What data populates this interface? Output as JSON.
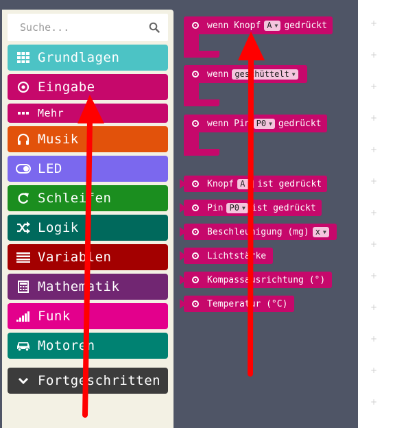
{
  "search": {
    "placeholder": "Suche..."
  },
  "categories": [
    {
      "label": "Grundlagen",
      "color": "#4cc3c5",
      "icon": "grid-icon"
    },
    {
      "label": "Eingabe",
      "color": "#c6086b",
      "icon": "target-icon"
    },
    {
      "label": "Mehr",
      "color": "#c6086b",
      "icon": "more-icon"
    },
    {
      "label": "Musik",
      "color": "#e2520b",
      "icon": "headphones-icon"
    },
    {
      "label": "LED",
      "color": "#7b68ee",
      "icon": "toggle-icon"
    },
    {
      "label": "Schleifen",
      "color": "#1b8e1f",
      "icon": "loop-icon"
    },
    {
      "label": "Logik",
      "color": "#00695c",
      "icon": "shuffle-icon"
    },
    {
      "label": "Variablen",
      "color": "#a30000",
      "icon": "list-icon"
    },
    {
      "label": "Mathematik",
      "color": "#712672",
      "icon": "calculator-icon"
    },
    {
      "label": "Funk",
      "color": "#e3008c",
      "icon": "signal-icon"
    },
    {
      "label": "Motoren",
      "color": "#008272",
      "icon": "car-icon"
    },
    {
      "label": "Fortgeschritten",
      "color": "#3c3c3c",
      "icon": "chevron-down-icon"
    }
  ],
  "blocks": {
    "on_button": {
      "pre": "wenn Knopf",
      "dd": "A",
      "post": "gedrückt"
    },
    "on_gesture": {
      "pre": "wenn",
      "dd": "geschüttelt",
      "post": ""
    },
    "on_pin": {
      "pre": "wenn Pin",
      "dd": "P0",
      "post": "gedrückt"
    },
    "button_pressed": {
      "pre": "Knopf",
      "dd": "A",
      "post": "ist gedrückt"
    },
    "pin_pressed": {
      "pre": "Pin",
      "dd": "P0",
      "post": "ist gedrückt"
    },
    "acceleration": {
      "pre": "Beschleunigung (mg)",
      "dd": "x",
      "post": ""
    },
    "light_level": {
      "pre": "Lichtstärke"
    },
    "compass": {
      "pre": "Kompassausrichtung (°)"
    },
    "temperature": {
      "pre": "Temperatur (°C)"
    }
  },
  "annotation_color": "#ff0000"
}
